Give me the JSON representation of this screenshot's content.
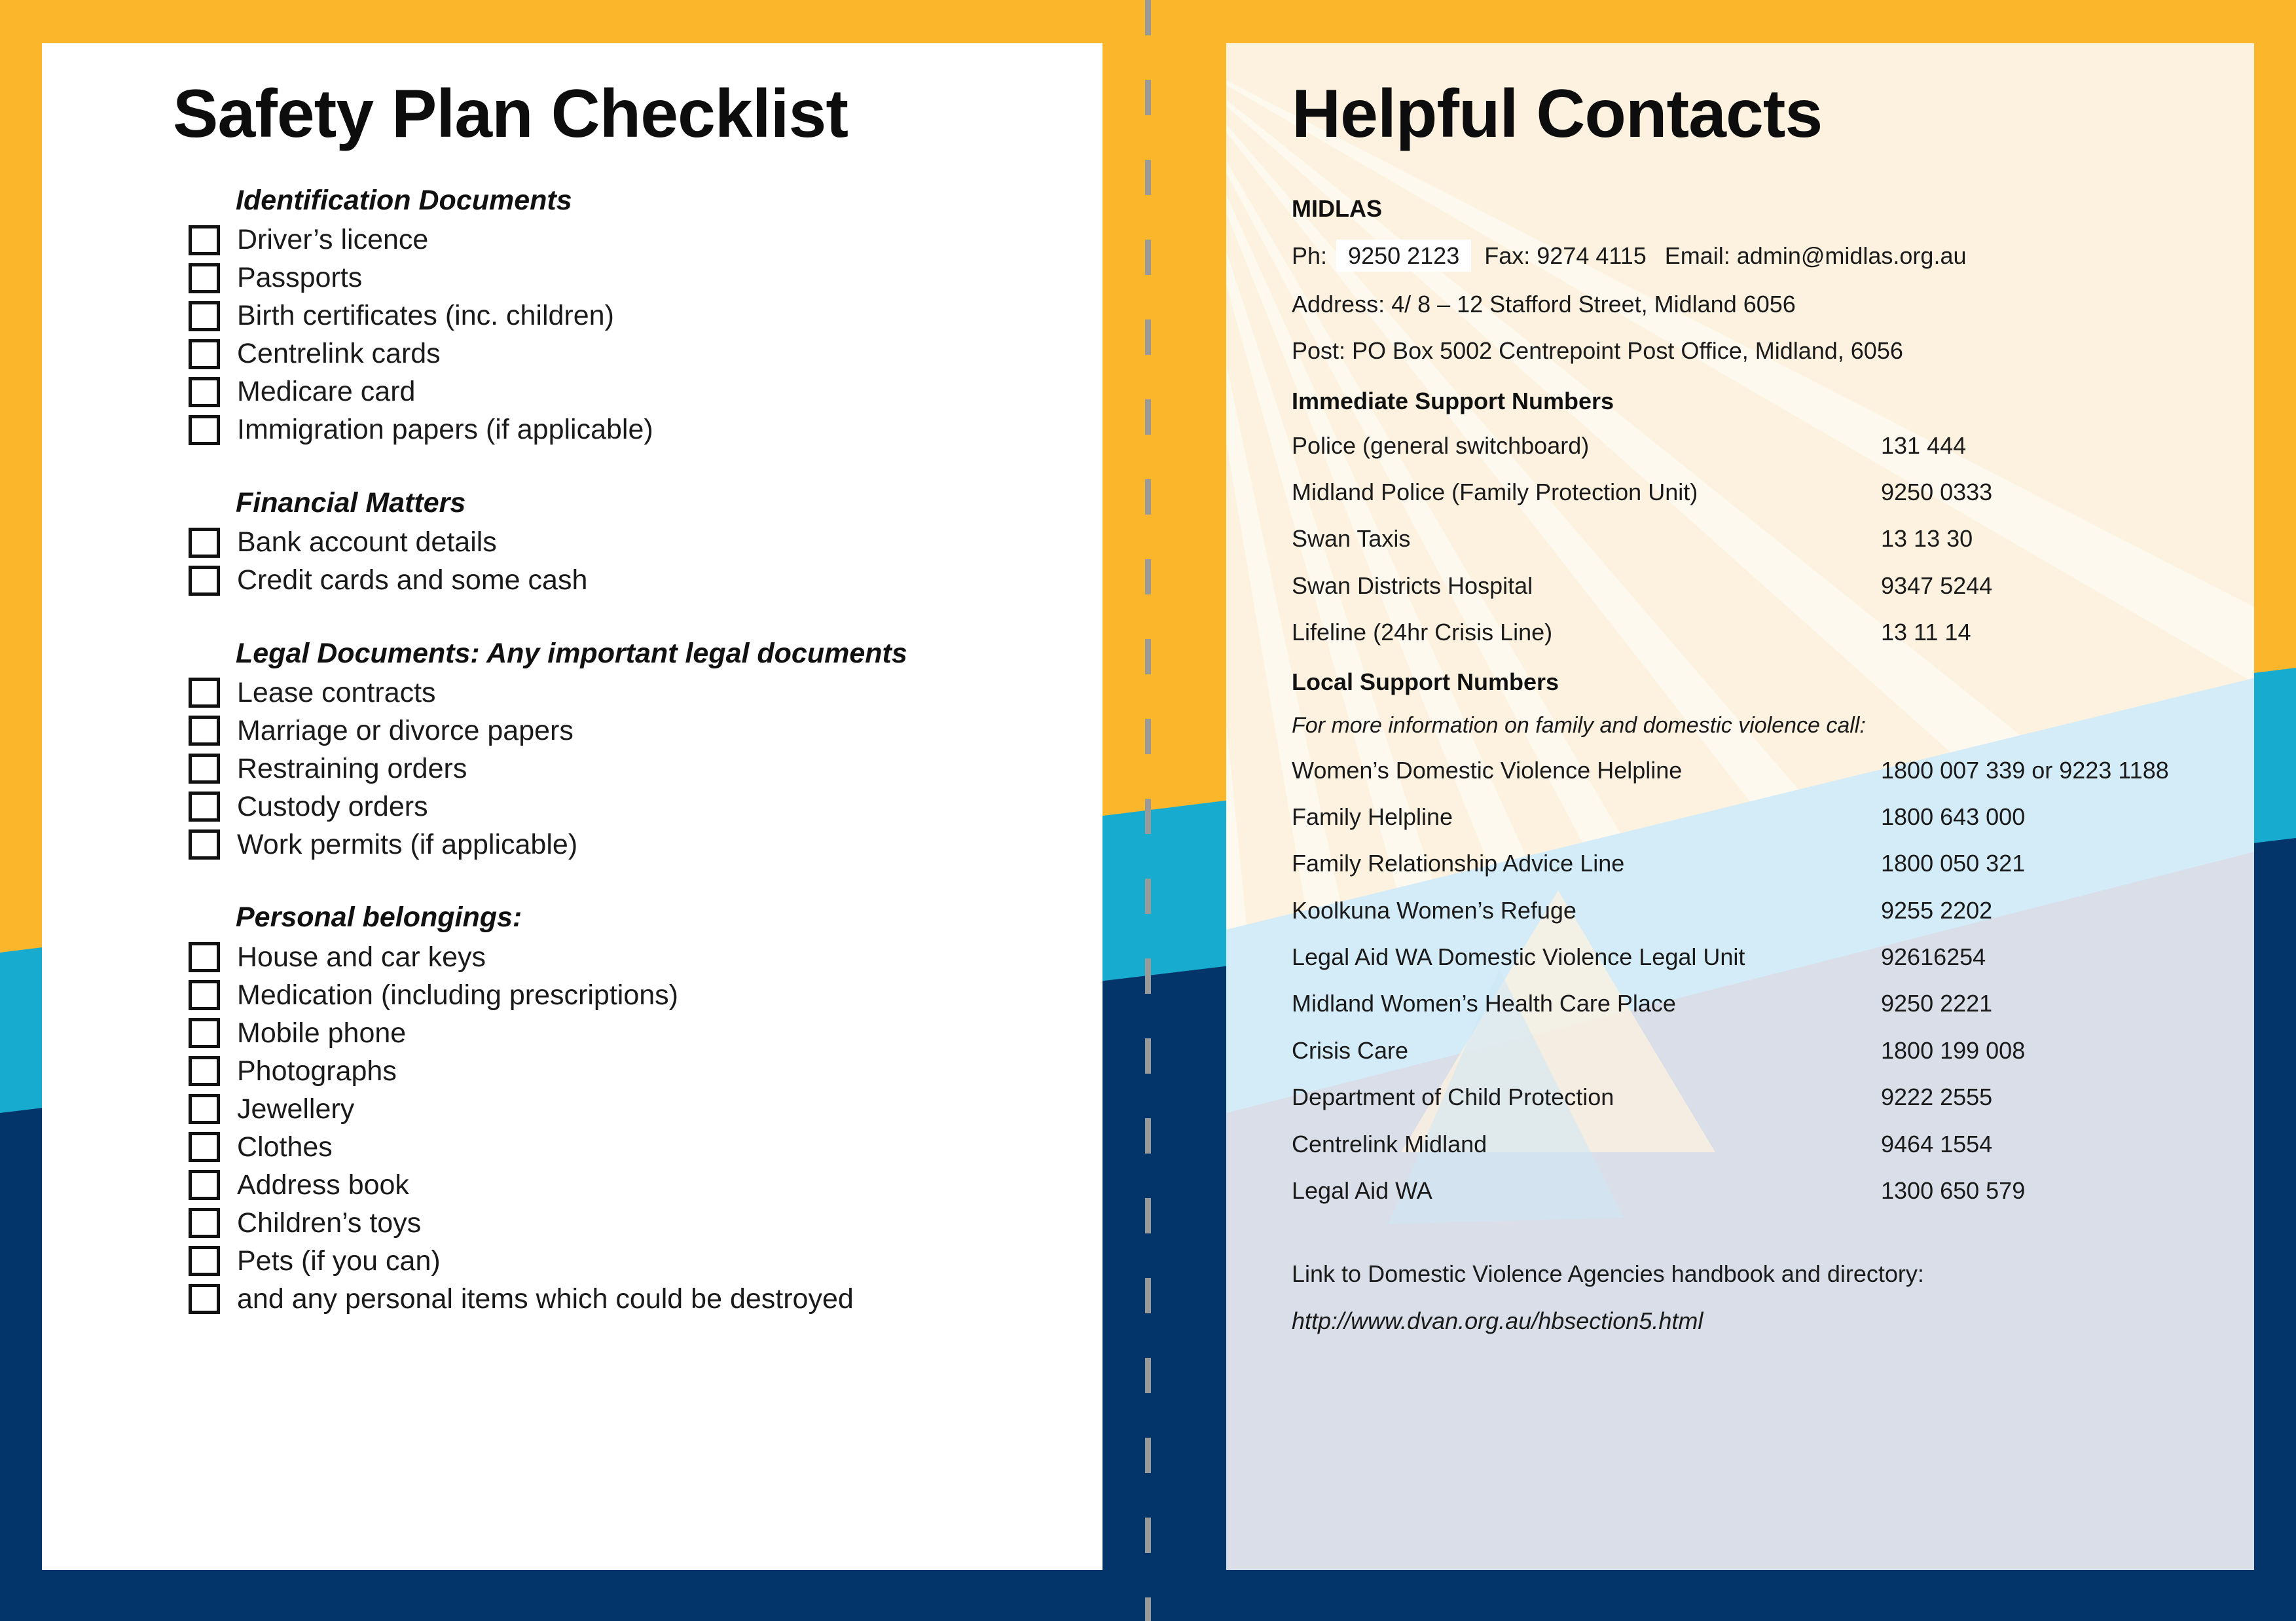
{
  "theme": {
    "border_orange": "#fcb62b",
    "accent_cyan": "#17ACCF",
    "accent_navy": "#03356B",
    "cream": "#FDF2DF",
    "pale_blue": "#D5E6F2",
    "grey_blue": "#D9DEE8",
    "fold_line": "#9a9a9a"
  },
  "left_panel": {
    "title": "Safety Plan Checklist",
    "sections": [
      {
        "heading": "Identification Documents",
        "items": [
          "Driver’s licence",
          "Passports",
          "Birth certificates (inc. children)",
          "Centrelink cards",
          "Medicare card",
          "Immigration papers (if applicable)"
        ]
      },
      {
        "heading": "Financial Matters",
        "items": [
          "Bank account details",
          "Credit cards and some cash"
        ]
      },
      {
        "heading": "Legal Documents: Any important legal documents",
        "items": [
          "Lease contracts",
          "Marriage or divorce papers",
          "Restraining orders",
          "Custody orders",
          "Work permits (if applicable)"
        ]
      },
      {
        "heading": "Personal belongings:",
        "items": [
          "House and car keys",
          "Medication (including prescriptions)",
          "Mobile phone",
          "Photographs",
          "Jewellery",
          "Clothes",
          "Address book",
          "Children’s toys",
          "Pets (if you can)",
          "and any personal items which could be destroyed"
        ]
      }
    ]
  },
  "right_panel": {
    "title": "Helpful Contacts",
    "org": {
      "name": "MIDLAS",
      "ph_label": "Ph:",
      "ph_value": "9250 2123",
      "fax": "Fax: 9274 4115",
      "email": "Email: admin@midlas.org.au",
      "address": "Address: 4/ 8 – 12 Stafford Street, Midland 6056",
      "post": "Post: PO Box 5002 Centrepoint Post Office, Midland, 6056"
    },
    "immediate": {
      "heading": "Immediate Support Numbers",
      "rows": [
        {
          "name": "Police (general switchboard)",
          "number": "131 444"
        },
        {
          "name": "Midland Police (Family Protection Unit)",
          "number": "9250 0333"
        },
        {
          "name": "Swan Taxis",
          "number": "13 13 30"
        },
        {
          "name": "Swan Districts Hospital",
          "number": "9347 5244"
        },
        {
          "name": "Lifeline (24hr Crisis Line)",
          "number": "13 11 14"
        }
      ]
    },
    "local": {
      "heading": "Local Support Numbers",
      "note": "For more information on family and domestic violence call:",
      "rows": [
        {
          "name": "Women’s Domestic Violence Helpline",
          "number": "1800 007 339 or 9223 1188"
        },
        {
          "name": "Family Helpline",
          "number": "1800 643 000"
        },
        {
          "name": "Family Relationship Advice Line",
          "number": "1800 050 321"
        },
        {
          "name": "Koolkuna Women’s Refuge",
          "number": "9255 2202"
        },
        {
          "name": "Legal Aid WA Domestic Violence Legal Unit",
          "number": "92616254"
        },
        {
          "name": "Midland Women’s Health Care Place",
          "number": "9250 2221"
        },
        {
          "name": "Crisis Care",
          "number": "1800 199 008"
        },
        {
          "name": "Department of Child Protection",
          "number": "9222 2555"
        },
        {
          "name": "Centrelink Midland",
          "number": "9464 1554"
        },
        {
          "name": "Legal Aid WA",
          "number": "1300 650 579"
        }
      ]
    },
    "link": {
      "label": "Link to Domestic Violence Agencies handbook and directory:",
      "url": "http://www.dvan.org.au/hbsection5.html"
    }
  }
}
